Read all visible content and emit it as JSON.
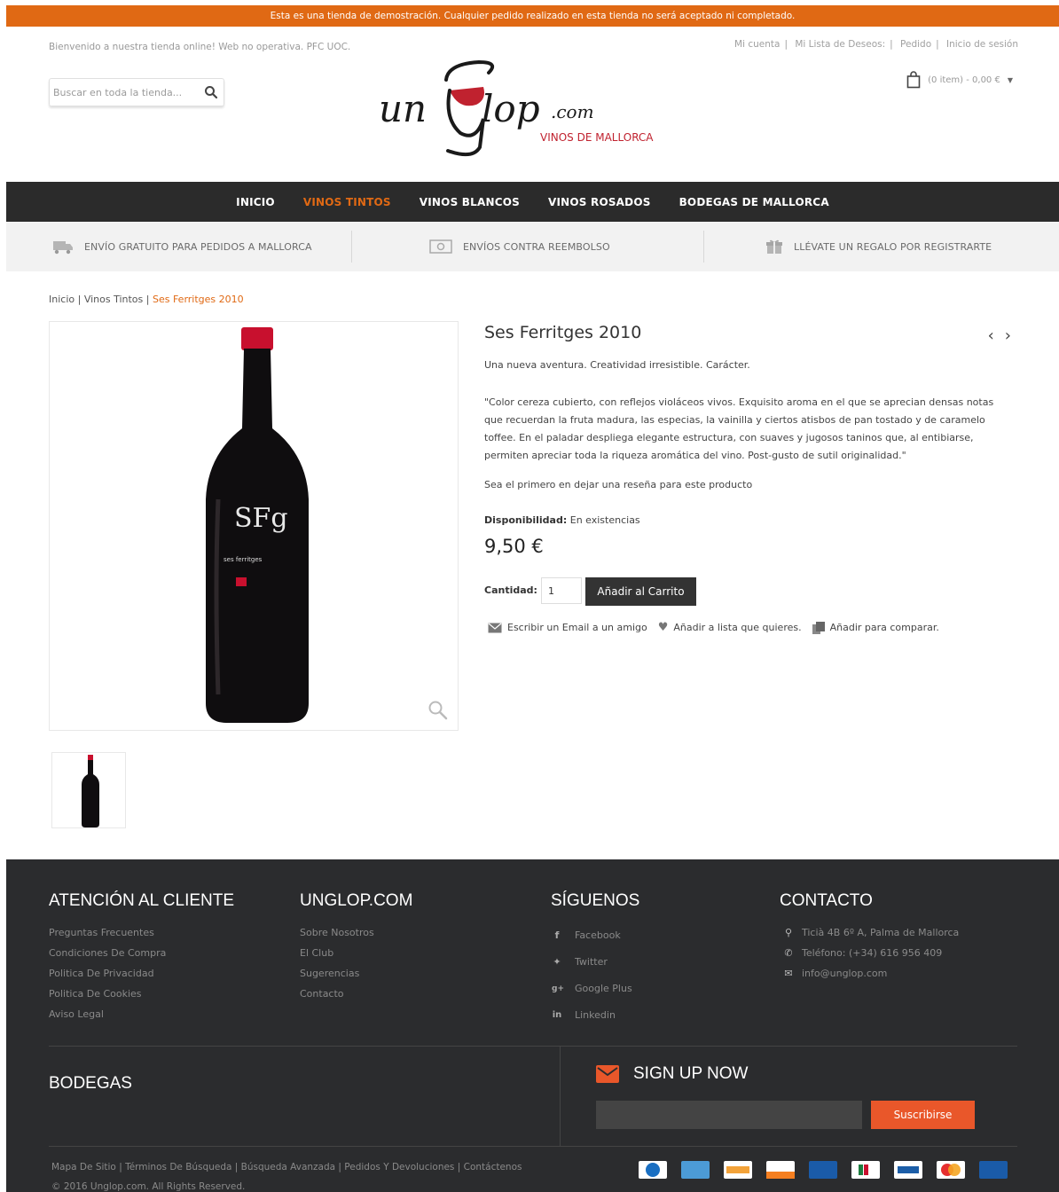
{
  "demo_notice": "Esta es una tienda de demostración. Cualquier pedido realizado en esta tienda no será aceptado ni completado.",
  "header": {
    "welcome": "Bienvenido a nuestra tienda online! Web no operativa. PFC UOC.",
    "search_placeholder": "Buscar en toda la tienda...",
    "top_links": [
      "Mi cuenta",
      "Mi Lista de Deseos:",
      "Pedido",
      "Inicio de sesión"
    ],
    "cart_summary": "(0 item) - 0,00 €",
    "logo_text": "unGlop",
    "logo_suffix": ".com",
    "logo_tagline": "VINOS DE MALLORCA"
  },
  "nav": [
    "INICIO",
    "VINOS TINTOS",
    "VINOS BLANCOS",
    "VINOS ROSADOS",
    "BODEGAS DE MALLORCA"
  ],
  "features": [
    "ENVÍO GRATUITO PARA PEDIDOS A MALLORCA",
    "ENVÍOS CONTRA REEMBOLSO",
    "LLÉVATE UN REGALO POR REGISTRARTE"
  ],
  "breadcrumb": {
    "home": "Inicio",
    "category": "Vinos Tintos",
    "current": "Ses Ferritges 2010"
  },
  "product": {
    "name": "Ses Ferritges 2010",
    "short": "Una nueva aventura. Creatividad irresistible. Carácter.",
    "description": "\"Color cereza cubierto, con reflejos violáceos vivos. Exquisito aroma en el que se aprecian densas notas que recuerdan la fruta madura, las especias, la vainilla y ciertos atisbos de pan tostado y de caramelo toffee. En el paladar despliega elegante estructura, con suaves y jugosos taninos que, al entibiarse, permiten apreciar toda la riqueza aromática del vino. Post-gusto de sutil originalidad.\"",
    "review_link": "Sea el primero en dejar una reseña para este producto",
    "availability_label": "Disponibilidad:",
    "availability_value": "En existencias",
    "price": "9,50 €",
    "qty_label": "Cantidad:",
    "qty_value": "1",
    "add_to_cart": "Añadir al Carrito",
    "actions": [
      "Escribir un Email a un amigo",
      "Añadir a lista que quieres.",
      "Añadir para comparar."
    ],
    "bottle_label_main": "SFg",
    "bottle_label_sub": "ses ferritges"
  },
  "footer": {
    "customer_title": "ATENCIÓN AL CLIENTE",
    "customer_links": [
      "Preguntas Frecuentes",
      "Condiciones De Compra",
      "Politica De Privacidad",
      "Politica De Cookies",
      "Aviso Legal"
    ],
    "company_title": "UNGLOP.COM",
    "company_links": [
      "Sobre Nosotros",
      "El Club",
      "Sugerencias",
      "Contacto"
    ],
    "follow_title": "SÍGUENOS",
    "social": [
      "Facebook",
      "Twitter",
      "Google Plus",
      "Linkedin"
    ],
    "contact_title": "CONTACTO",
    "contact": [
      "Ticià 4B 6º A, Palma de Mallorca",
      "Teléfono: (+34) 616 956 409",
      "info@unglop.com"
    ],
    "bodegas_title": "BODEGAS",
    "signup_title": "SIGN UP NOW",
    "subscribe": "Suscribirse",
    "bottom_links": "Mapa De Sitio | Términos De Búsqueda | Búsqueda Avanzada | Pedidos Y Devoluciones | Contáctenos",
    "copyright": "© 2016 Unglop.com. All Rights Reserved."
  },
  "colors": {
    "accent": "#e06914",
    "nav_bg": "#2b2b2b",
    "footer_bg": "#2b2c2e",
    "subscribe": "#e9572a"
  }
}
